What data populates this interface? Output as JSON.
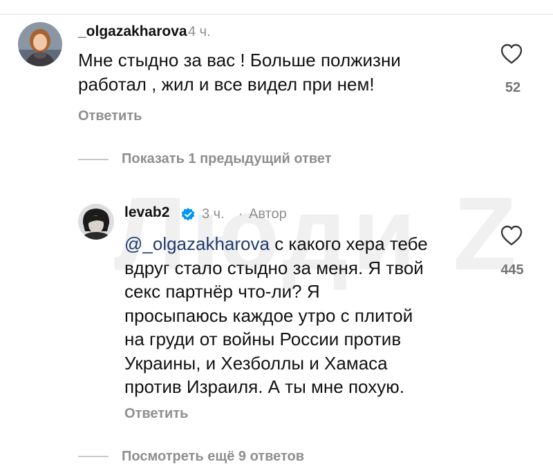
{
  "comment": {
    "username": "_olgazakharova",
    "time": "4 ч.",
    "lines": [
      "Мне стыдно за вас ! Больше полжизни",
      "работал , жил и все видел при нем!"
    ],
    "reply_label": "Ответить",
    "like_count": "52",
    "avatar_icon": "woman-portrait-avatar"
  },
  "previous_replies_label": "Показать 1 предыдущий ответ",
  "reply": {
    "username": "levab2",
    "verified_icon": "verified-badge-icon",
    "time": "3 ч.",
    "separator": "·",
    "author_label": "Автор",
    "mention": "@_olgazakharova",
    "lines": [
      " с какого хера тебе",
      "вдруг стало стыдно за меня. Я твой",
      "секс партнёр что-ли? Я",
      "просыпаюсь каждое утро с плитой",
      "на груди от войны России против",
      "Украины, и Хезболлы и Хамаса",
      "против Израиля. А ты мне похую."
    ],
    "reply_label": "Ответить",
    "like_count": "445",
    "avatar_icon": "man-portrait-avatar"
  },
  "more_replies_label": "Посмотреть ещё 9 ответов",
  "watermark": "Люди Z",
  "colors": {
    "text": "#111111",
    "muted": "#8e8e8e",
    "mention": "#1f3b6d",
    "verified": "#0095f6",
    "divider": "#c7c7c7"
  }
}
